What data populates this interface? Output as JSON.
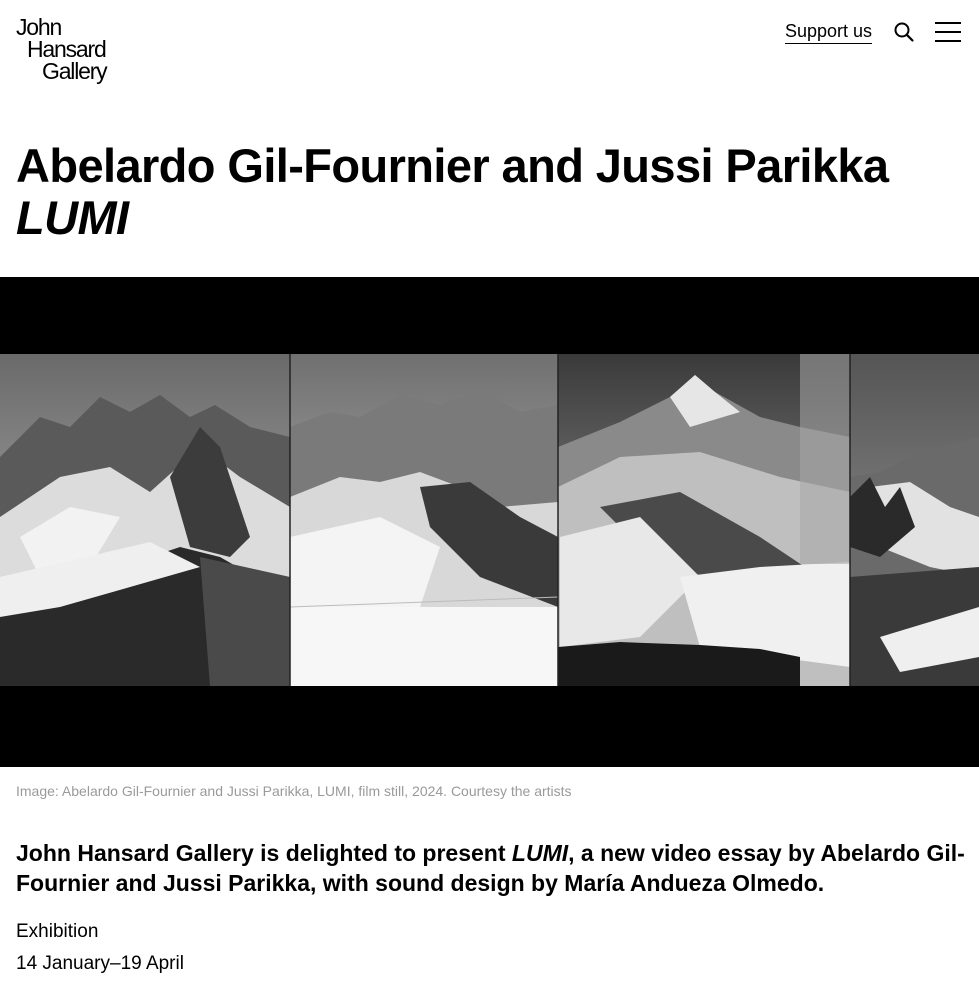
{
  "header": {
    "logo_line1": "John",
    "logo_line2": "Hansard",
    "logo_line3": "Gallery",
    "support_label": "Support us",
    "search_icon": "search-icon",
    "menu_icon": "hamburger-menu-icon"
  },
  "exhibition": {
    "artists": "Abelardo Gil-Fournier and Jussi Parikka",
    "title": "LUMI",
    "image_caption": "Image: Abelardo Gil-Fournier and Jussi Parikka, LUMI, film still, 2024. Courtesy the artists",
    "intro_before": "John Hansard Gallery is delighted to present ",
    "intro_title": "LUMI",
    "intro_after": ", a new video essay by Abelardo Gil-Fournier and Jussi Parikka, with sound design by María Andueza Olmedo.",
    "type": "Exhibition",
    "dates": "14 January–19 April"
  },
  "colors": {
    "text": "#000000",
    "caption": "#9a9a9a",
    "background": "#ffffff"
  }
}
